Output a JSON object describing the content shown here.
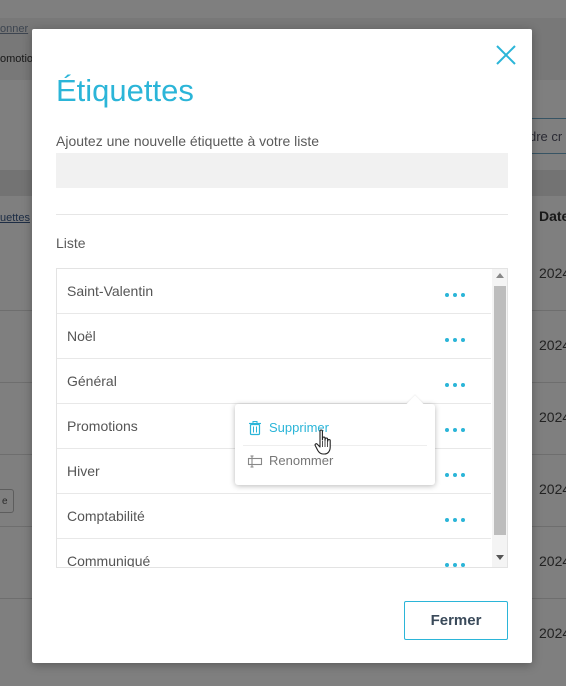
{
  "background": {
    "breadcrumb": "onner",
    "promo": "omotio",
    "right_button": "dre cr",
    "head_left": "uettes",
    "head_right": "Date",
    "dates": [
      "2024",
      "2024",
      "2024",
      "2024",
      "2024",
      "2024"
    ],
    "tag": "e"
  },
  "modal": {
    "title": "Étiquettes",
    "add_label": "Ajoutez une nouvelle étiquette à votre liste",
    "add_placeholder": "",
    "list_label": "Liste",
    "items": [
      {
        "name": "Saint-Valentin"
      },
      {
        "name": "Noël"
      },
      {
        "name": "Général"
      },
      {
        "name": "Promotions"
      },
      {
        "name": "Hiver"
      },
      {
        "name": "Comptabilité"
      },
      {
        "name": "Communiqué"
      }
    ],
    "context_menu": {
      "delete_label": "Supprimer",
      "rename_label": "Renommer"
    },
    "close_button_label": "Fermer"
  },
  "colors": {
    "accent": "#2bb5d8",
    "overlay": "rgba(0,0,0,0.5)"
  },
  "icons": {
    "close": "close-icon",
    "more": "more-dots-icon",
    "delete": "trash-icon",
    "rename": "rename-icon",
    "cursor": "hand-pointer-icon"
  }
}
